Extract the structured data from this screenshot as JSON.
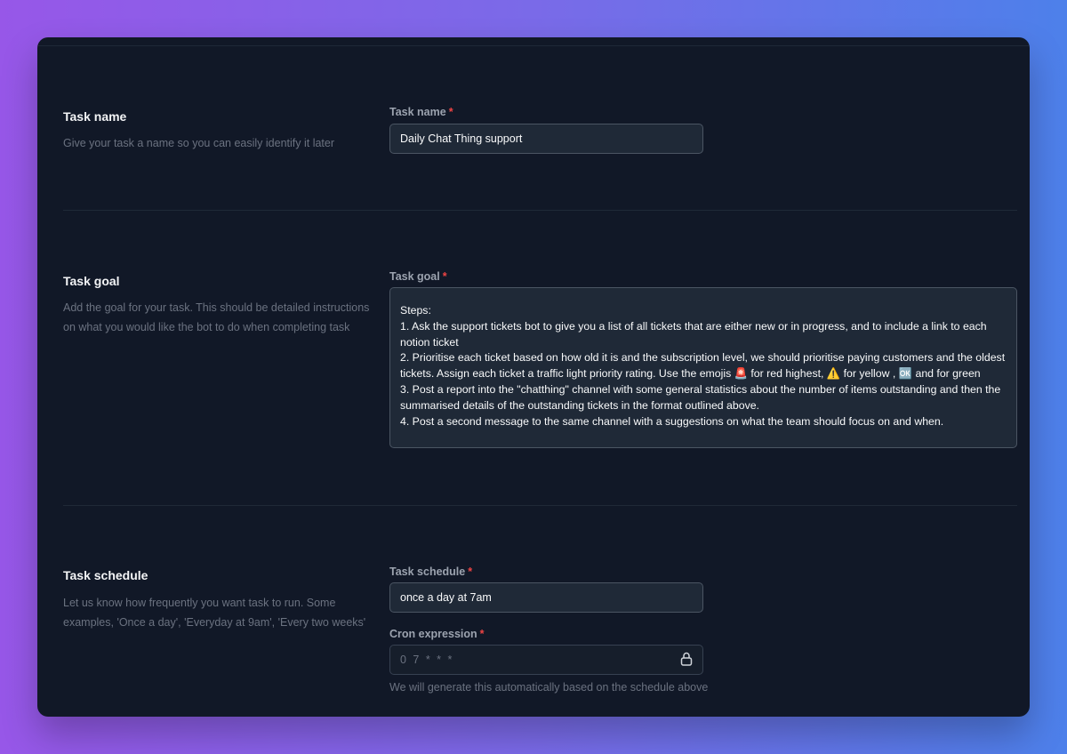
{
  "sections": {
    "task_name": {
      "title": "Task name",
      "description": "Give your task a name so you can easily identify it later",
      "field_label": "Task name",
      "required_mark": "*",
      "value": "Daily Chat Thing support"
    },
    "task_goal": {
      "title": "Task goal",
      "description": "Add the goal for your task. This should be detailed instructions on what you would like the bot to do when completing task",
      "field_label": "Task goal",
      "required_mark": "*",
      "lines": [
        "Steps:",
        "1. Ask the support tickets bot to give you a list of all tickets that are either new or in progress, and to include a link to each notion ticket",
        "2. Prioritise each ticket based on how old it is and the subscription level, we should prioritise paying customers and the oldest tickets. Assign each ticket a traffic light priority rating.  Use the emojis 🚨 for red highest, ⚠️ for yellow , 🆗 and for green",
        "3. Post a report into the \"chatthing\" channel with some general statistics about the number of items outstanding and then the summarised details of the outstanding tickets in the format outlined above.",
        "4. Post a second message to the same channel with a suggestions on what the team should focus on and when."
      ]
    },
    "task_schedule": {
      "title": "Task schedule",
      "description": "Let us know how frequently you want task to run. Some examples, 'Once a day', 'Everyday at 9am', 'Every two weeks'",
      "field_label": "Task schedule",
      "required_mark": "*",
      "value": "once a day at 7am",
      "cron_label": "Cron expression",
      "cron_required_mark": "*",
      "cron_value": "0 7 * * *",
      "cron_hint": "We will generate this automatically based on the schedule above",
      "lock_icon": "lock-icon"
    }
  }
}
